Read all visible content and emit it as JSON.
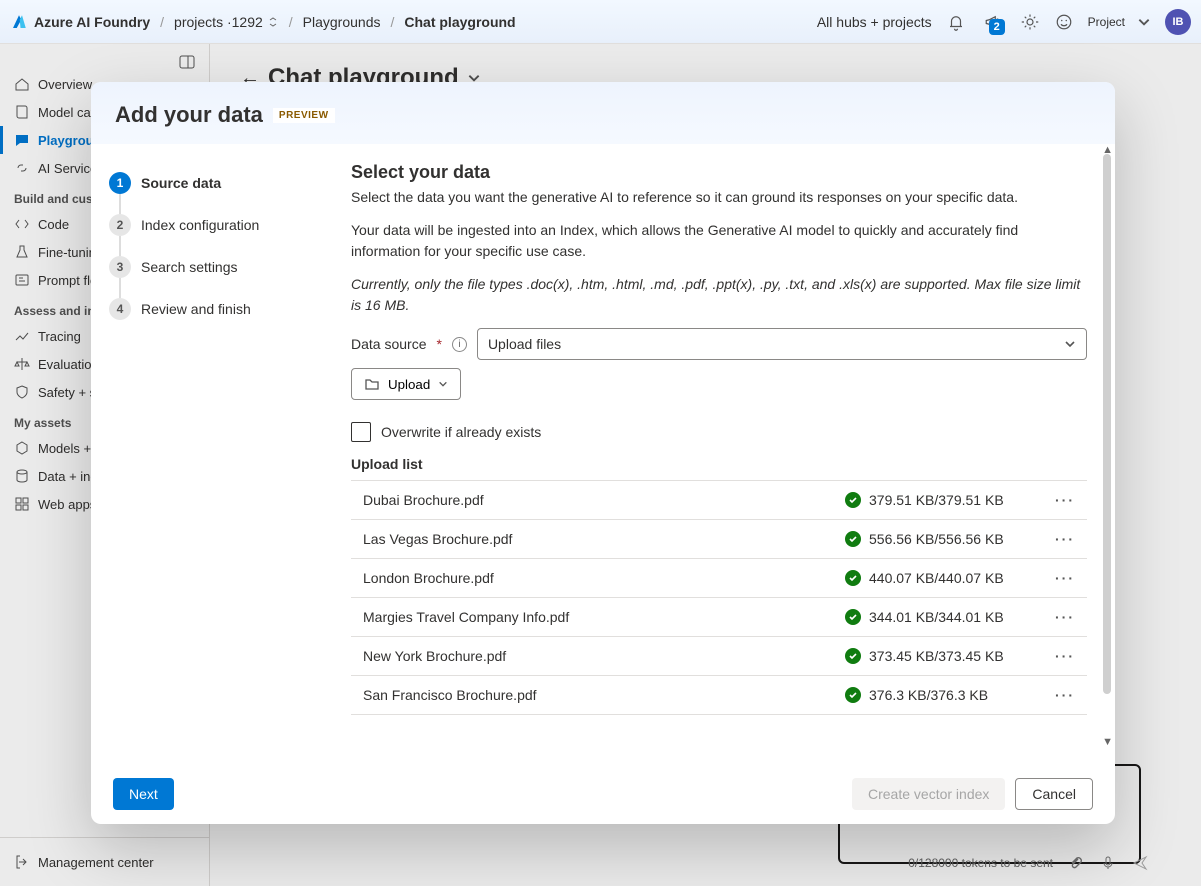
{
  "topbar": {
    "brand": "Azure AI Foundry",
    "crumb_project": "projects ·1292",
    "crumb_playgrounds": "Playgrounds",
    "crumb_chat": "Chat playground",
    "hubs_label": "All hubs + projects",
    "notif_badge": "2",
    "project_label": "Project",
    "avatar_initials": "IB"
  },
  "sidebar": {
    "items": {
      "overview": "Overview",
      "model": "Model catalog",
      "playgrounds": "Playgrounds",
      "ai_services": "AI Services"
    },
    "group_build": "Build and customize",
    "build": {
      "code": "Code",
      "finetune": "Fine-tuning",
      "prompt": "Prompt flow"
    },
    "group_assess": "Assess and improve",
    "assess": {
      "tracing": "Tracing",
      "evals": "Evaluation",
      "safety": "Safety + security"
    },
    "group_assets": "My assets",
    "assets": {
      "models": "Models + endpoints",
      "data": "Data + indexes",
      "web": "Web apps"
    },
    "management": "Management center"
  },
  "main": {
    "title": "Chat playground",
    "tokens": "0/128000 tokens to be sent"
  },
  "modal": {
    "title": "Add your data",
    "preview_tag": "PREVIEW",
    "steps": {
      "s1": "Source data",
      "s2": "Index configuration",
      "s3": "Search settings",
      "s4": "Review and finish"
    },
    "pane": {
      "heading": "Select your data",
      "intro": "Select the data you want the generative AI to reference so it can ground its responses on your specific data.",
      "para2": "Your data will be ingested into an Index, which allows the Generative AI model to quickly and accurately find information for your specific use case.",
      "note": "Currently, only the file types .doc(x), .htm, .html, .md, .pdf, .ppt(x), .py, .txt, and .xls(x) are supported. Max file size limit is 16 MB.",
      "ds_label": "Data source",
      "ds_value": "Upload files",
      "upload_btn": "Upload",
      "overwrite": "Overwrite if already exists",
      "list_title": "Upload list"
    },
    "files": [
      {
        "name": "Dubai Brochure.pdf",
        "size": "379.51 KB/379.51 KB"
      },
      {
        "name": "Las Vegas Brochure.pdf",
        "size": "556.56 KB/556.56 KB"
      },
      {
        "name": "London Brochure.pdf",
        "size": "440.07 KB/440.07 KB"
      },
      {
        "name": "Margies Travel Company Info.pdf",
        "size": "344.01 KB/344.01 KB"
      },
      {
        "name": "New York Brochure.pdf",
        "size": "373.45 KB/373.45 KB"
      },
      {
        "name": "San Francisco Brochure.pdf",
        "size": "376.3 KB/376.3 KB"
      }
    ],
    "footer": {
      "next": "Next",
      "create": "Create vector index",
      "cancel": "Cancel"
    }
  }
}
